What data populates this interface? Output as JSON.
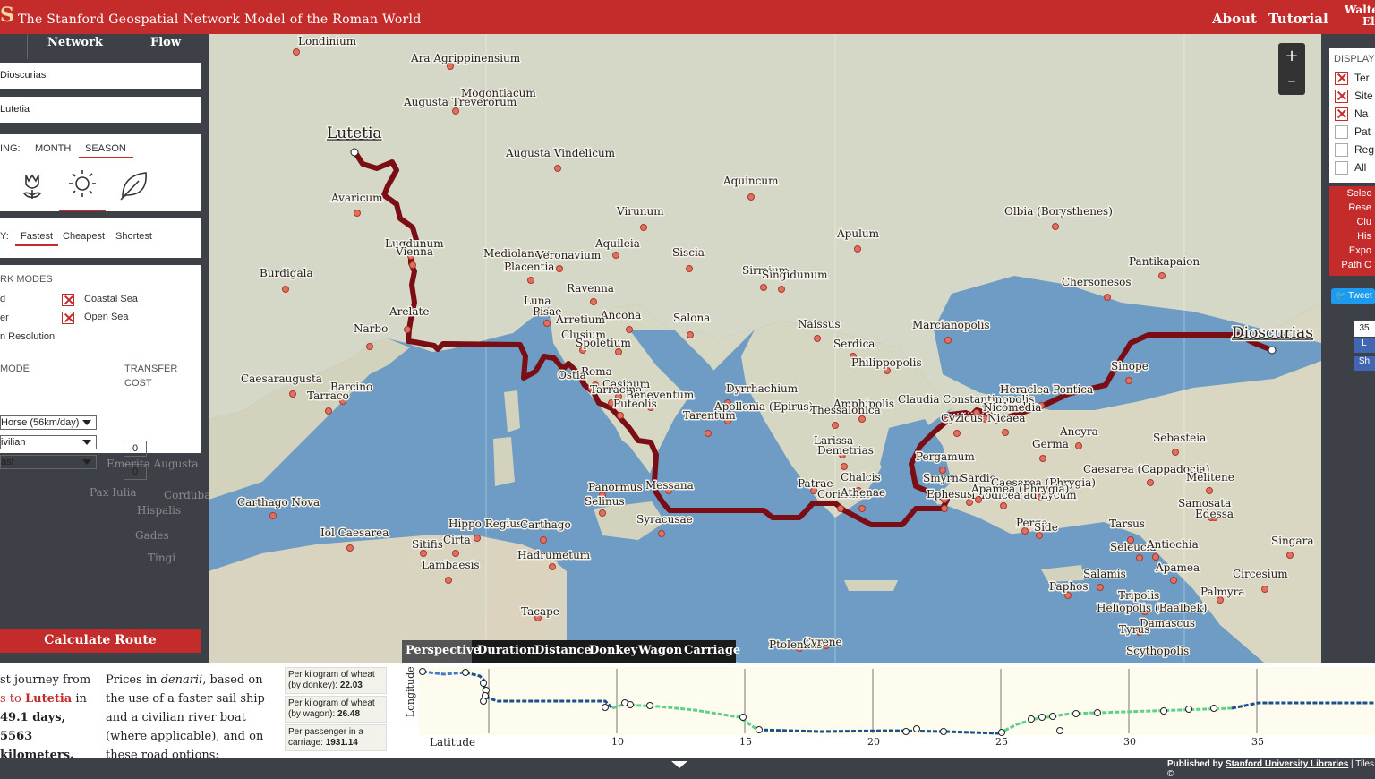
{
  "header": {
    "logo_letter": "S",
    "title": "The Stanford Geospatial Network Model of the Roman World",
    "about": "About",
    "tutorial": "Tutorial",
    "user_line1": "Walte",
    "user_line2": "El"
  },
  "left": {
    "tabs": [
      "Network",
      "Flow"
    ],
    "from_value": "Dioscurias",
    "to_value": "Lutetia",
    "season": {
      "label": "ING:",
      "month": "MONTH",
      "season": "SEASON",
      "icons": [
        "spring-flower-icon",
        "summer-sun-icon",
        "autumn-leaf-icon"
      ]
    },
    "priority": {
      "label": "Y:",
      "options": [
        "Fastest",
        "Cheapest",
        "Shortest"
      ],
      "selected": "Fastest"
    },
    "network_modes": {
      "title": "RK MODES",
      "left_items": [
        "d",
        "er",
        "n Resolution"
      ],
      "right_items": [
        {
          "label": "Coastal Sea",
          "checked": true
        },
        {
          "label": "Open Sea",
          "checked": true
        }
      ]
    },
    "mode": {
      "title": "MODE",
      "selects": [
        "Horse (56km/day)",
        "ivilian",
        "ast"
      ]
    },
    "transfer": {
      "title": "TRANSFER",
      "title2": "COST",
      "values": [
        "0",
        "0"
      ]
    },
    "calculate": "Calculate Route"
  },
  "map": {
    "zoom_in": "+",
    "zoom_out": "–",
    "cities": [
      {
        "name": "Londinium",
        "big": false
      },
      {
        "name": "Ara Agrippinensium",
        "big": false
      },
      {
        "name": "Mogontiacum",
        "big": false
      },
      {
        "name": "Augusta Treverorum",
        "big": false
      },
      {
        "name": "Lutetia",
        "big": true
      },
      {
        "name": "Augusta Vindelicum",
        "big": false
      },
      {
        "name": "Aquincum",
        "big": false
      },
      {
        "name": "Avaricum",
        "big": false
      },
      {
        "name": "Virunum",
        "big": false
      },
      {
        "name": "Olbia (Borysthenes)",
        "big": false
      },
      {
        "name": "Apulum",
        "big": false
      },
      {
        "name": "Lugdunum",
        "big": false
      },
      {
        "name": "Vienna",
        "big": false
      },
      {
        "name": "Aquileia",
        "big": false
      },
      {
        "name": "Mediolanum",
        "big": false
      },
      {
        "name": "Veronavium",
        "big": false
      },
      {
        "name": "Siscia",
        "big": false
      },
      {
        "name": "Placentia",
        "big": false
      },
      {
        "name": "Pantikapaion",
        "big": false
      },
      {
        "name": "Burdigala",
        "big": false
      },
      {
        "name": "Sirmium",
        "big": false
      },
      {
        "name": "Singidunum",
        "big": false
      },
      {
        "name": "Chersonesos",
        "big": false
      },
      {
        "name": "Ravenna",
        "big": false
      },
      {
        "name": "Luna",
        "big": false
      },
      {
        "name": "Pisae",
        "big": false
      },
      {
        "name": "Arelate",
        "big": false
      },
      {
        "name": "Ancona",
        "big": false
      },
      {
        "name": "Salona",
        "big": false
      },
      {
        "name": "Arretium",
        "big": false
      },
      {
        "name": "Naissus",
        "big": false
      },
      {
        "name": "Marcianopolis",
        "big": false
      },
      {
        "name": "Dioscurias",
        "big": true
      },
      {
        "name": "Narbo",
        "big": false
      },
      {
        "name": "Clusium",
        "big": false
      },
      {
        "name": "Spoletium",
        "big": false
      },
      {
        "name": "Serdica",
        "big": false
      },
      {
        "name": "Philippopolis",
        "big": false
      },
      {
        "name": "Sinope",
        "big": false
      },
      {
        "name": "Caesaraugusta",
        "big": false
      },
      {
        "name": "Roma",
        "big": false
      },
      {
        "name": "Ostia",
        "big": false
      },
      {
        "name": "Barcino",
        "big": false
      },
      {
        "name": "Tarraco",
        "big": false
      },
      {
        "name": "Casinum",
        "big": false
      },
      {
        "name": "Dyrrhachium",
        "big": false
      },
      {
        "name": "Heraclea Pontica",
        "big": false
      },
      {
        "name": "Tarracina",
        "big": false
      },
      {
        "name": "Beneventum",
        "big": false
      },
      {
        "name": "Amphipolis",
        "big": false
      },
      {
        "name": "Claudia",
        "big": false
      },
      {
        "name": "Constantinopolis",
        "big": false
      },
      {
        "name": "Puteolis",
        "big": false
      },
      {
        "name": "Apollonia (Epirus)",
        "big": false
      },
      {
        "name": "Thessalonica",
        "big": false
      },
      {
        "name": "Chalcedon",
        "big": false
      },
      {
        "name": "Nicomedia",
        "big": false
      },
      {
        "name": "Tarentum",
        "big": false
      },
      {
        "name": "Cyzicus",
        "big": false
      },
      {
        "name": "Nicaea",
        "big": false
      },
      {
        "name": "Ancyra",
        "big": false
      },
      {
        "name": "Sebasteia",
        "big": false
      },
      {
        "name": "Larissa",
        "big": false
      },
      {
        "name": "Germa",
        "big": false
      },
      {
        "name": "Demetrias",
        "big": false
      },
      {
        "name": "Emerita Augusta",
        "big": false,
        "dim": true
      },
      {
        "name": "Pergamum",
        "big": false
      },
      {
        "name": "Caesarea (Cappadocia)",
        "big": false
      },
      {
        "name": "Chalcis",
        "big": false
      },
      {
        "name": "Melitene",
        "big": false
      },
      {
        "name": "Smyrna",
        "big": false
      },
      {
        "name": "Sardis",
        "big": false
      },
      {
        "name": "Patrae",
        "big": false
      },
      {
        "name": "Caesarea (Phrygia)",
        "big": false
      },
      {
        "name": "Pax Iulia",
        "big": false,
        "dim": true
      },
      {
        "name": "Corduba",
        "big": false,
        "dim": true
      },
      {
        "name": "Panormus",
        "big": false
      },
      {
        "name": "Messana",
        "big": false
      },
      {
        "name": "Corinthus",
        "big": false
      },
      {
        "name": "Athenae",
        "big": false
      },
      {
        "name": "Ephesus",
        "big": false
      },
      {
        "name": "Laodicea ad Lycum",
        "big": false
      },
      {
        "name": "Apamea (Phrygia)",
        "big": false
      },
      {
        "name": "Carthago Nova",
        "big": false
      },
      {
        "name": "Selinus",
        "big": false
      },
      {
        "name": "Hispalis",
        "big": false,
        "dim": true
      },
      {
        "name": "Samosata",
        "big": false
      },
      {
        "name": "Edessa",
        "big": false
      },
      {
        "name": "Syracusae",
        "big": false
      },
      {
        "name": "Tarsus",
        "big": false
      },
      {
        "name": "Perge",
        "big": false
      },
      {
        "name": "Side",
        "big": false
      },
      {
        "name": "Hippo Regius",
        "big": false
      },
      {
        "name": "Carthago",
        "big": false
      },
      {
        "name": "Gades",
        "big": false,
        "dim": true
      },
      {
        "name": "Iol Caesarea",
        "big": false
      },
      {
        "name": "Singara",
        "big": false
      },
      {
        "name": "Cirta",
        "big": false
      },
      {
        "name": "Sitifis",
        "big": false
      },
      {
        "name": "Seleucia",
        "big": false
      },
      {
        "name": "Antiochia",
        "big": false
      },
      {
        "name": "Tingi",
        "big": false,
        "dim": true
      },
      {
        "name": "Hadrumetum",
        "big": false
      },
      {
        "name": "Lambaesis",
        "big": false
      },
      {
        "name": "Apamea",
        "big": false
      },
      {
        "name": "Salamis",
        "big": false
      },
      {
        "name": "Circesium",
        "big": false
      },
      {
        "name": "Paphos",
        "big": false
      },
      {
        "name": "Palmyra",
        "big": false
      },
      {
        "name": "Tripolis",
        "big": false
      },
      {
        "name": "Heliopolis (Baalbek)",
        "big": false
      },
      {
        "name": "Tacape",
        "big": false
      },
      {
        "name": "Damascus",
        "big": false
      },
      {
        "name": "Tyrus",
        "big": false
      },
      {
        "name": "Scythopolis",
        "big": false
      },
      {
        "name": "Ptolemais",
        "big": false
      },
      {
        "name": "Cyrene",
        "big": false
      }
    ]
  },
  "right": {
    "display_title": "DISPLAY",
    "display_items": [
      {
        "label": "Ter",
        "checked": true
      },
      {
        "label": "Site",
        "checked": true
      },
      {
        "label": "Na",
        "checked": true
      },
      {
        "label": "Pat",
        "checked": false
      },
      {
        "label": "Reg",
        "checked": false
      },
      {
        "label": "All",
        "checked": false
      }
    ],
    "actions": [
      "Selec",
      "Rese",
      "Clu",
      "His",
      "Expo",
      "Path C"
    ],
    "tweet": "Tweet",
    "count": "35",
    "fb_like": "L",
    "fb_share": "Sh"
  },
  "bottom": {
    "summary": {
      "line1": "st journey from",
      "from_prefix": "s to ",
      "dest": "Lutetia",
      "in": " in",
      "days": "49.1 days,",
      "km": "5563 kilometers."
    },
    "price_text_1": "Prices in ",
    "price_text_em": "denarii",
    "price_text_2": ", based on the use of a faster sail ship and a civilian river boat (where applicable), and on these road options:",
    "prices": [
      {
        "label": "Per kilogram of wheat (by donkey):",
        "value": "22.03"
      },
      {
        "label": "Per kilogram of wheat (by wagon):",
        "value": "26.48"
      },
      {
        "label": "Per passenger in a carriage:",
        "value": "1931.14"
      }
    ],
    "chart_tabs": [
      "Perspective",
      "Duration",
      "Distance",
      "Donkey",
      "Wagon",
      "Carriage"
    ],
    "y_label": "Longitude",
    "x_label": "Latitude",
    "x_ticks": [
      "10",
      "15",
      "20",
      "25",
      "30",
      "35"
    ]
  },
  "footer": {
    "published_prefix": "Published by ",
    "published_link": "Stanford University Libraries",
    "tiles": " | Tiles ©"
  }
}
